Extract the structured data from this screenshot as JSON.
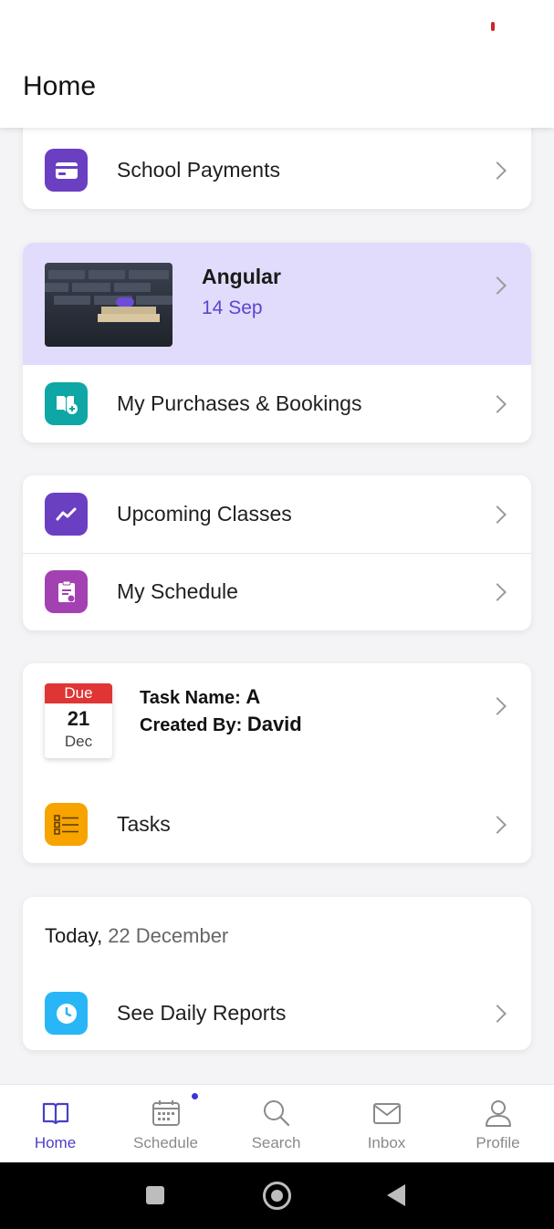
{
  "header": {
    "title": "Home"
  },
  "rows": {
    "school_payments": {
      "label": "School Payments",
      "icon": "card-icon",
      "color": "#6a3fc1"
    },
    "purchases": {
      "label": "My Purchases & Bookings",
      "icon": "book-add-icon",
      "color": "#0fa6a6"
    },
    "upcoming": {
      "label": "Upcoming Classes",
      "icon": "trend-icon",
      "color": "#6a3fc1"
    },
    "schedule": {
      "label": "My Schedule",
      "icon": "clipboard-icon",
      "color": "#a341b3"
    },
    "tasks": {
      "label": "Tasks",
      "icon": "list-icon",
      "color": "#f7a300"
    },
    "daily_reports": {
      "label": "See Daily Reports",
      "icon": "clock-icon",
      "color": "#29b6f6"
    }
  },
  "course": {
    "title": "Angular",
    "date": "14 Sep",
    "highlight": "#e1dcfb"
  },
  "task": {
    "due_label": "Due",
    "due_day": "21",
    "due_month": "Dec",
    "name_label": "Task Name:",
    "name_value": "A",
    "created_label": "Created By:",
    "created_value": "David"
  },
  "today": {
    "label": "Today,",
    "date": "22 December"
  },
  "nav": [
    {
      "label": "Home",
      "icon": "book-open-icon",
      "active": true
    },
    {
      "label": "Schedule",
      "icon": "calendar-icon",
      "active": false
    },
    {
      "label": "Search",
      "icon": "search-icon",
      "active": false
    },
    {
      "label": "Inbox",
      "icon": "mail-icon",
      "active": false
    },
    {
      "label": "Profile",
      "icon": "person-icon",
      "active": false
    }
  ],
  "colors": {
    "accent": "#4a3fc6",
    "due": "#df3535"
  }
}
